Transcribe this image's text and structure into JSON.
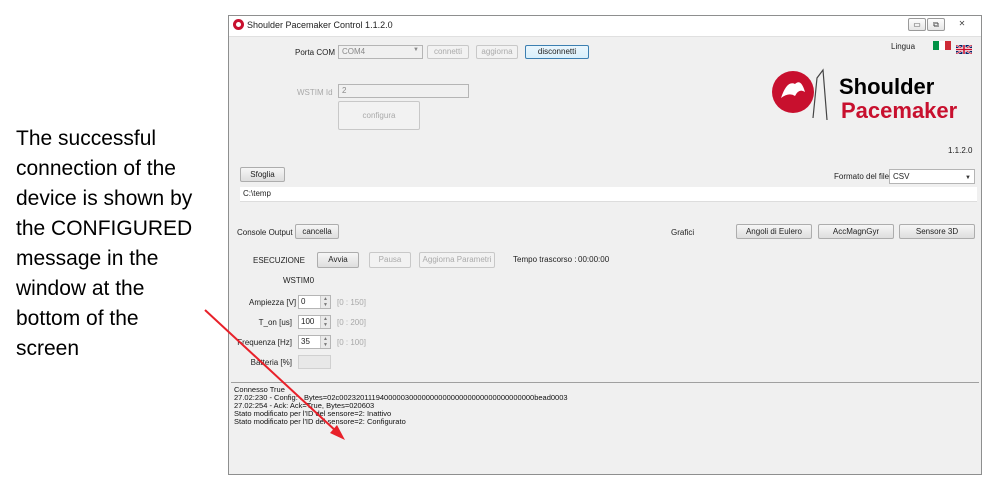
{
  "caption": "The successful\nconnection of the\ndevice is shown by\nthe CONFIGURED\nmessage in the\nwindow at the\nbottom of the\nscreen",
  "window": {
    "title": "Shoulder Pacemaker Control 1.1.2.0",
    "minimize": "▭",
    "restore": "⧉",
    "close": "✕"
  },
  "connection": {
    "porta_com_label": "Porta COM",
    "porta_com_value": "COM4",
    "connetti": "connetti",
    "aggiorna": "aggiorna",
    "disconnetti": "disconnetti",
    "wstim_label": "WSTIM Id",
    "wstim_value": "2",
    "configura": "configura"
  },
  "lingua": {
    "label": "Lingua",
    "flags": [
      "italian-flag",
      "uk-flag"
    ],
    "it_colors": [
      "#009246",
      "#ffffff",
      "#ce2b37"
    ]
  },
  "logo": {
    "line1": "Shoulder",
    "line2": "Pacemaker",
    "version": "1.1.2.0",
    "line1_color": "#595959",
    "line2_color": "#c8102e"
  },
  "file": {
    "sfoglia": "Sfoglia",
    "path": "C:\\temp",
    "formato_label": "Formato del file",
    "formato_value": "CSV"
  },
  "console_output": {
    "label": "Console Output",
    "cancella": "cancella"
  },
  "grafici": {
    "label": "Grafici",
    "buttons": [
      "Angoli di Eulero",
      "AccMagnGyr",
      "Sensore 3D"
    ]
  },
  "esecuzione": {
    "label": "ESECUZIONE",
    "avvia": "Avvia",
    "pausa": "Pausa",
    "aggiorna_parametri": "Aggiorna Parametri",
    "tempo_label": "Tempo trascorso :",
    "tempo_value": "00:00:00"
  },
  "wstim": {
    "title": "WSTIM0",
    "params": [
      {
        "label": "Ampiezza [V]",
        "value": "0",
        "range": "[0 : 150]"
      },
      {
        "label": "T_on [us]",
        "value": "100",
        "range": "[0 : 200]"
      },
      {
        "label": "Frequenza [Hz]",
        "value": "35",
        "range": "[0 : 100]"
      }
    ],
    "battery_label": "Batteria [%]"
  },
  "console_lines": [
    "Connesso True",
    "27.02:230 - Config: . Bytes=02c00232011194000003000000000000000000000000000000bead0003",
    "27.02:254 - Ack: Ack=True, Bytes=020603",
    "Stato modificato per l'ID del sensore=2: Inattivo",
    "Stato modificato per l'ID del sensore=2: Configurato"
  ],
  "arrow_color": "#e8212a"
}
